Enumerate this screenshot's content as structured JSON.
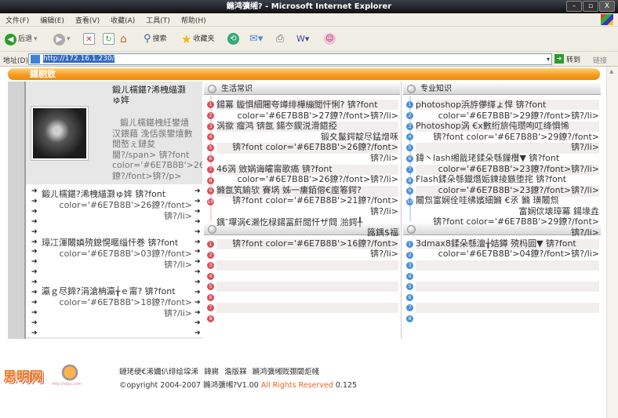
{
  "window": {
    "title": "鏅鸿彍缃? - Microsoft Internet Explorer",
    "min": "–",
    "max": "▫",
    "close": "X"
  },
  "menu": [
    "文件(F)",
    "编辑(E)",
    "查看(V)",
    "收藏(A)",
    "工具(T)",
    "帮助(H)"
  ],
  "toolbar": {
    "back": "后退",
    "search": "搜索",
    "favorites": "收藏夹"
  },
  "address": {
    "label": "地址(D)",
    "url": "http://172.16.1.230/",
    "go": "转到",
    "links": "链接"
  },
  "banner": {
    "title": "鍚剧敓"
  },
  "profile": {
    "title": "鍛ㄦ檽鍖?浠栧緢灏ゅ姩",
    "desc": "鍛ㄦ檽鍖栧紝鐢熺汉鍡藉 浼佸彂鐢熺數閲嶅ぇ鏈夋閫?/span> 锛?font color='#6E7B8B'>26鐐?/font>锛?/p>"
  },
  "left_list": [
    {
      "title": "鍛ㄦ檽鍖?浠栧緢灏ゅ姩 锛?font",
      "meta": "color='#6E7B8B'>26鐐?/font>\n锛?/li>"
    },
    {
      "title": "璋冮渾闂嫃殑鎴愰暱缁忓巻 锛?font",
      "meta": "color='#6E7B8B'>03鐐?/font>\n锛?/li>"
    },
    {
      "title": "瀛ｇ尽鍗?涓滄柟瀛╁ｅ甯? 锛?font",
      "meta": "color='#6E7B8B'>18鐐?/font>\n锛?/li>"
    }
  ],
  "sections": [
    {
      "title": "生活常识",
      "badge_color": "#d9505a",
      "items": [
        {
          "title": "鍚冪  鏇惧細闀夸竴绯樺繃閲忓悧? 锛?font",
          "meta": "color='#6E7B8B'>27鐐?/font>锛?/li>"
        },
        {
          "title": "涡撳  瘤鸿  锛氬  鍚冭鍥涚滑鍣掗",
          "meta": "锻夊鬣鍔靛尽錳熷咊\n锛?font color='#6E7B8B'>26鐐?/font>\n锛?/li>"
        },
        {
          "title": "46涡  敓娲诲皬甯歌瘑          锛?font",
          "meta": "color='#6E7B8B'>26鐐?/font>锛?/li>"
        },
        {
          "title": "鏅氬笂鍮欤  賽埚  姊一瘻銆傛€庢箞鍔?",
          "meta": "锛?font color='#6E7B8B'>21鐐?/font>\n锛?/li>"
        },
        {
          "title": "鍝″墠涡€濑忔椂鍚冨皯閲忓ザ閰  湁鍔╀",
          "meta": "簬鍝$福\n锛?font color='#6E7B8B'>16鐐?/font>\n锛?/li>"
        }
      ]
    },
    {
      "title": "专业知识",
      "badge_color": "#4a8fd6",
      "items": [
        {
          "title": "photoshop浜斿儚缂ょ悍            锛?font",
          "meta": "color='#6E7B8B'>29鐐?/font>锛?/li>"
        },
        {
          "title": "Photoshop涡  €x數绗旂伅瓒呴叿绛惧悕",
          "meta": "锛?font color='#6E7B8B'>29鐐?/font>\n锛?/li>"
        },
        {
          "title": "鍏丶lash缃戠珯鍒朵綔鏁欑▼       锛?font",
          "meta": "color='#6E7B8B'>23鐐?/font>锛?/li>"
        },
        {
          "title": "Flash鍒朵綔鐡熸姤鍊掕鏃堕挓  锛?font",
          "meta": "color='#6E7B8B'>23鐐?/font>锛?/li>"
        },
        {
          "title": "闂炰富娴佺哇绋嬪細鏅  €氶  鏅  璜闂炰",
          "meta": "富娴佽壊璋冪  鍚堟垚\n锛?font color='#6E7B8B'>29鐐?/font>\n锛?/li>"
        },
        {
          "title": "3dmax8鍒朵綔澶╁姞鐏  殑杩囩▼ 锛?font",
          "meta": "color='#6E7B8B'>04鐐?/font>锛?/li>"
        }
      ]
    }
  ],
  "footer": {
    "logo_text": "思明网",
    "logo_url": "http://siqu.com",
    "links": "鏈珯绠€浠嬭仈绯绘垜浠  鍏嶈  澹版槑  鏅鸿彍缃戝弸閾炬帴",
    "copyright": "©opyright 2004-2007 鏅鸿彍缃?V1.00",
    "rights": "All Rights Reserved",
    "version": "0.125"
  }
}
